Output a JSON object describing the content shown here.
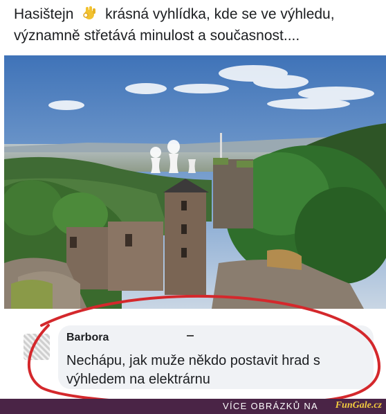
{
  "post": {
    "line1_before": "Hasištejn",
    "line1_after": "krásná vyhlídka, kde se ve výhledu,",
    "line2": "významně střetává minulost a současnost....",
    "emoji": "ok-hand-emoji"
  },
  "photo": {
    "subject": "castle-ruin-with-power-plant-view"
  },
  "comment": {
    "author": "Barbora",
    "text": "Nechápu, jak muže někdo postavit hrad s výhledem na elektrárnu"
  },
  "footer": {
    "label": "VÍCE OBRÁZKŮ NA",
    "brand": "FunGale.cz"
  },
  "colors": {
    "footer_bg": "#4a2446",
    "brand": "#f3cb3e",
    "annotation": "#d4282c",
    "bubble": "#f0f2f5"
  }
}
